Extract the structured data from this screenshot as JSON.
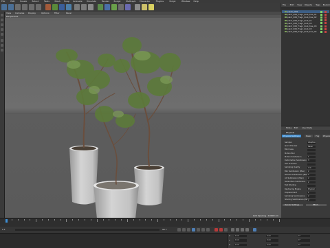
{
  "menubar": {
    "items": [
      "File",
      "Edit",
      "Create",
      "Select",
      "Tools",
      "Mesh",
      "Snap",
      "Animate",
      "Simulate",
      "Render",
      "Sculpt",
      "MoGraph",
      "Character",
      "Plugins",
      "Script",
      "Window",
      "Help"
    ]
  },
  "viewport": {
    "menu": [
      "View",
      "Cameras",
      "Display",
      "Options",
      "Filter",
      "Panel"
    ],
    "name": "Perspective",
    "grid_status": "Grid Spacing : 10000 cm"
  },
  "object_manager": {
    "menu": [
      "File",
      "Edit",
      "View",
      "Objects",
      "Tags",
      "Bookmarks"
    ],
    "objects": [
      {
        "name": "plants_069"
      },
      {
        "name": "plant_069_Frag1_blob_tree_01"
      },
      {
        "name": "plant_069_Frag1_blob_tree_02"
      },
      {
        "name": "plant_069_Frag1_blob_01"
      },
      {
        "name": "plant_069_Frag1_blob_02"
      },
      {
        "name": "plant_069_Frag1_blob_tree_03"
      },
      {
        "name": "plant_069_Frag1_blob_03"
      },
      {
        "name": "plant_069_Frag1_blob_tree_04"
      }
    ]
  },
  "attribute_manager": {
    "menu": [
      "Mode",
      "Edit",
      "User Data"
    ],
    "object_title": "Physical",
    "tabs": [
      "Physical Settings",
      "Basic",
      "Fog",
      "Physical"
    ],
    "rows": [
      {
        "label": "Sampler",
        "value": "Adaptive"
      },
      {
        "label": "Quick Preview",
        "value": "Never"
      },
      {
        "label": "Blurriness",
        "value": ""
      },
      {
        "label": "Motion Blur",
        "value": ""
      },
      {
        "label": "Motion Subdivision",
        "value": "1"
      },
      {
        "label": "Deformation Subdivision",
        "value": "3"
      },
      {
        "label": "Hair Primitive",
        "value": ""
      },
      {
        "label": "Sampling Quality",
        "value": "Low"
      },
      {
        "label": "Blur Subdivision (Max)",
        "value": "2"
      },
      {
        "label": "Shadow Subdivision (Max)",
        "value": "2"
      },
      {
        "label": "AO Subdivision (Max)",
        "value": "2"
      },
      {
        "label": "Subsurface Subdivision",
        "value": "2"
      },
      {
        "label": "Fast Shading",
        "value": ""
      },
      {
        "label": "Raytracing Engine",
        "value": "Physical"
      },
      {
        "label": "Displacement",
        "value": "1"
      },
      {
        "label": "Sampling Subdivisions",
        "value": "2"
      },
      {
        "label": "Shading Subdivisions (Max)",
        "value": "2"
      }
    ],
    "buttons": [
      "Render Settings...",
      "Effect..."
    ]
  },
  "timeline": {
    "start_frame": "0 F",
    "end_frame": "90 F",
    "current": "0 F"
  },
  "coordinates": {
    "rows": [
      {
        "axis": "X",
        "pos": "0 cm",
        "size": "0 cm",
        "rot": "0 °"
      },
      {
        "axis": "Y",
        "pos": "0 cm",
        "size": "0 cm",
        "rot": "0 °"
      },
      {
        "axis": "Z",
        "pos": "0 cm",
        "size": "0 cm",
        "rot": "0 °"
      }
    ]
  },
  "colors": {
    "accent": "#3d8fd6",
    "foliage": "#5c7a3a",
    "trunk": "#6a4e3d",
    "pot": "#cfcfcf"
  }
}
